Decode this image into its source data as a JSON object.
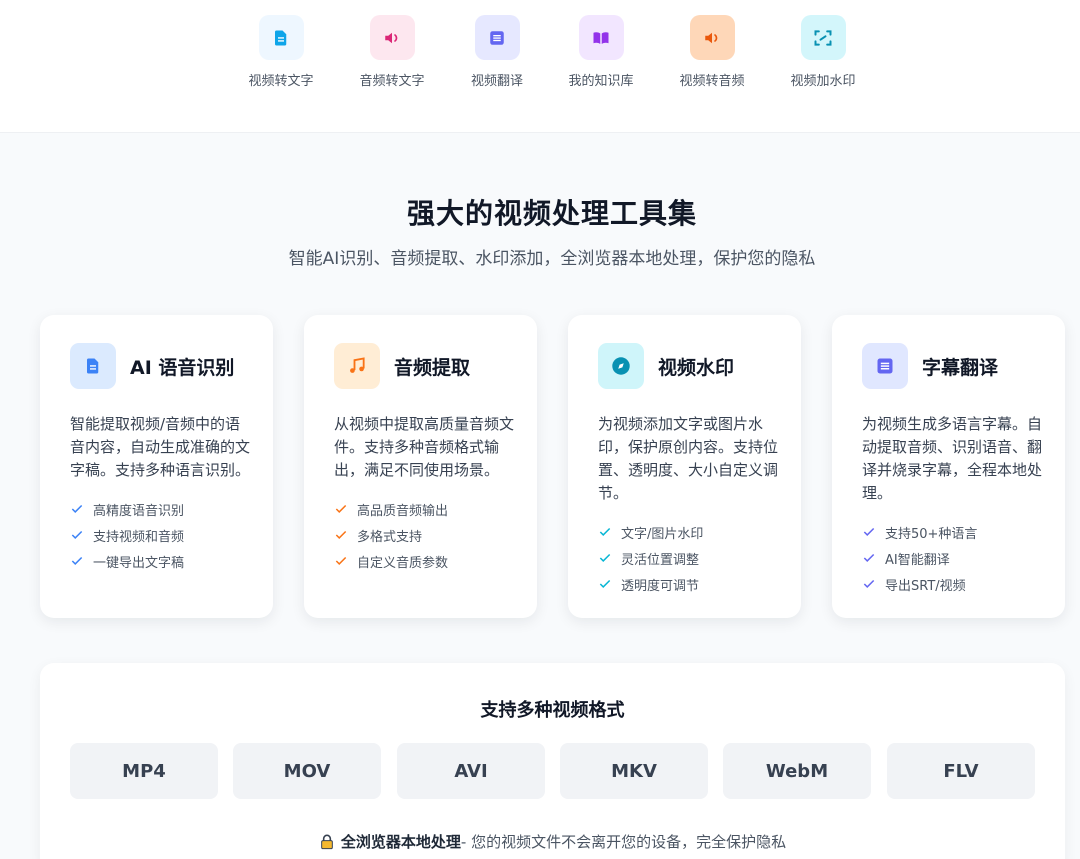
{
  "nav": {
    "items": [
      {
        "label": "视频转文字",
        "icon": "document-icon",
        "color": "#0ea5e9",
        "bg": "#eef7ff"
      },
      {
        "label": "音频转文字",
        "icon": "speaker-icon",
        "color": "#db2777",
        "bg": "#fde7ef"
      },
      {
        "label": "视频翻译",
        "icon": "text-lines-icon",
        "color": "#6366f1",
        "bg": "#e6e8ff"
      },
      {
        "label": "我的知识库",
        "icon": "book-icon",
        "color": "#9333ea",
        "bg": "#f2e6ff"
      },
      {
        "label": "视频转音频",
        "icon": "speaker-icon",
        "color": "#ea580c",
        "bg": "#fed7b8"
      },
      {
        "label": "视频加水印",
        "icon": "scan-frame-icon",
        "color": "#0891b2",
        "bg": "#d3f6fb"
      }
    ]
  },
  "hero": {
    "title": "强大的视频处理工具集",
    "subtitle": "智能AI识别、音频提取、水印添加，全浏览器本地处理，保护您的隐私"
  },
  "cards": [
    {
      "title": "AI 语音识别",
      "icon": "document-icon",
      "accent": "#3b82f6",
      "icon_bg": "#dbeafe",
      "desc": "智能提取视频/音频中的语音内容，自动生成准确的文字稿。支持多种语言识别。",
      "features": [
        "高精度语音识别",
        "支持视频和音频",
        "一键导出文字稿"
      ]
    },
    {
      "title": "音频提取",
      "icon": "music-note-icon",
      "accent": "#f97316",
      "icon_bg": "#ffedd5",
      "desc": "从视频中提取高质量音频文件。支持多种音频格式输出，满足不同使用场景。",
      "features": [
        "高品质音频输出",
        "多格式支持",
        "自定义音质参数"
      ]
    },
    {
      "title": "视频水印",
      "icon": "compass-icon",
      "accent": "#06b6d4",
      "icon_bg": "#cff5fa",
      "desc": "为视频添加文字或图片水印，保护原创内容。支持位置、透明度、大小自定义调节。",
      "features": [
        "文字/图片水印",
        "灵活位置调整",
        "透明度可调节"
      ]
    },
    {
      "title": "字幕翻译",
      "icon": "text-lines-icon",
      "accent": "#6366f1",
      "icon_bg": "#e0e7ff",
      "desc": "为视频生成多语言字幕。自动提取音频、识别语音、翻译并烧录字幕，全程本地处理。",
      "features": [
        "支持50+种语言",
        "AI智能翻译",
        "导出SRT/视频"
      ]
    }
  ],
  "formats": {
    "title": "支持多种视频格式",
    "items": [
      "MP4",
      "MOV",
      "AVI",
      "MKV",
      "WebM",
      "FLV"
    ],
    "privacy_bold": "全浏览器本地处理",
    "privacy_text": " - 您的视频文件不会离开您的设备，完全保护隐私"
  }
}
